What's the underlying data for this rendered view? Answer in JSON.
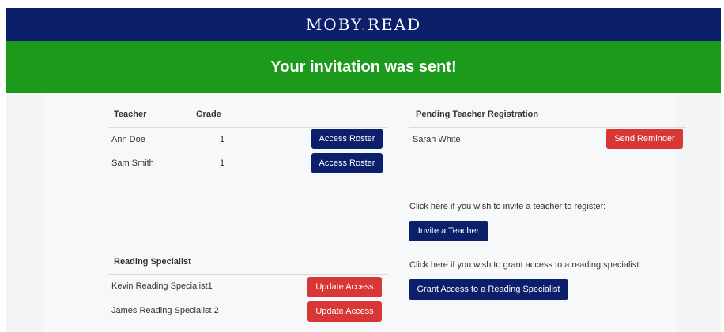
{
  "header": {
    "logo_left": "MOBY",
    "logo_dot": ".",
    "logo_right": "READ"
  },
  "banner": {
    "message": "Your invitation was sent!"
  },
  "teachers": {
    "col_teacher": "Teacher",
    "col_grade": "Grade",
    "rows": [
      {
        "name": "Ann Doe",
        "grade": "1",
        "action": "Access Roster"
      },
      {
        "name": "Sam Smith",
        "grade": "1",
        "action": "Access Roster"
      }
    ]
  },
  "pending": {
    "heading": "Pending Teacher Registration",
    "rows": [
      {
        "name": "Sarah White",
        "action": "Send Reminder"
      }
    ]
  },
  "invite": {
    "prompt": "Click here if you wish to invite a teacher to register:",
    "button": "Invite a Teacher"
  },
  "grant": {
    "prompt": "Click here if you wish to grant access to a reading specialist:",
    "button": "Grant Access to a Reading Specialist"
  },
  "specialists": {
    "heading": "Reading Specialist",
    "rows": [
      {
        "name": "Kevin Reading Specialist1",
        "action": "Update Access"
      },
      {
        "name": "James Reading Specialist 2",
        "action": "Update Access"
      }
    ]
  },
  "colors": {
    "navy": "#0b1f6b",
    "green": "#1b9a1b",
    "red": "#d93636"
  }
}
